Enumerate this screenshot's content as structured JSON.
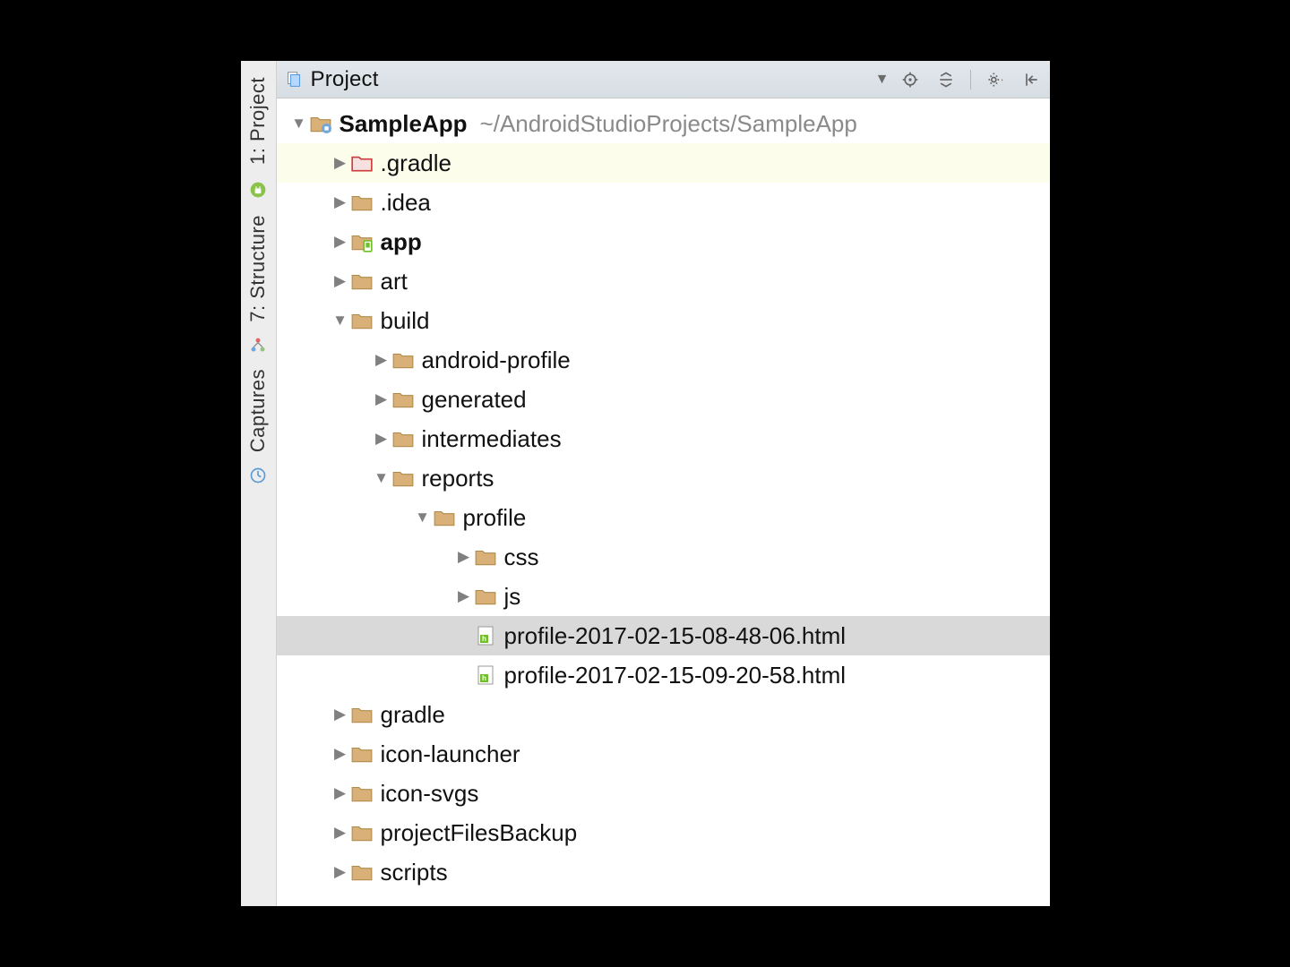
{
  "leftRail": {
    "tabs": [
      {
        "id": "project",
        "label": "1: Project"
      },
      {
        "id": "structure",
        "label": "7: Structure"
      },
      {
        "id": "captures",
        "label": "Captures"
      }
    ]
  },
  "titleBar": {
    "title": "Project"
  },
  "tree": {
    "rootName": "SampleApp",
    "rootPath": "~/AndroidStudioProjects/SampleApp",
    "nodes": [
      {
        "depth": 0,
        "expanded": true,
        "iconType": "module",
        "label": "SampleApp",
        "bold": true,
        "pathHint": "~/AndroidStudioProjects/SampleApp"
      },
      {
        "depth": 1,
        "expanded": false,
        "iconType": "folder-red",
        "label": ".gradle",
        "highlight": true
      },
      {
        "depth": 1,
        "expanded": false,
        "iconType": "folder",
        "label": ".idea"
      },
      {
        "depth": 1,
        "expanded": false,
        "iconType": "app-module",
        "label": "app",
        "bold": true
      },
      {
        "depth": 1,
        "expanded": false,
        "iconType": "folder",
        "label": "art"
      },
      {
        "depth": 1,
        "expanded": true,
        "iconType": "folder",
        "label": "build"
      },
      {
        "depth": 2,
        "expanded": false,
        "iconType": "folder",
        "label": "android-profile"
      },
      {
        "depth": 2,
        "expanded": false,
        "iconType": "folder",
        "label": "generated"
      },
      {
        "depth": 2,
        "expanded": false,
        "iconType": "folder",
        "label": "intermediates"
      },
      {
        "depth": 2,
        "expanded": true,
        "iconType": "folder",
        "label": "reports"
      },
      {
        "depth": 3,
        "expanded": true,
        "iconType": "folder",
        "label": "profile"
      },
      {
        "depth": 4,
        "expanded": false,
        "iconType": "folder",
        "label": "css"
      },
      {
        "depth": 4,
        "expanded": false,
        "iconType": "folder",
        "label": "js"
      },
      {
        "depth": 4,
        "leaf": true,
        "iconType": "html",
        "label": "profile-2017-02-15-08-48-06.html",
        "selected": true
      },
      {
        "depth": 4,
        "leaf": true,
        "iconType": "html",
        "label": "profile-2017-02-15-09-20-58.html"
      },
      {
        "depth": 1,
        "expanded": false,
        "iconType": "folder",
        "label": "gradle"
      },
      {
        "depth": 1,
        "expanded": false,
        "iconType": "folder",
        "label": "icon-launcher"
      },
      {
        "depth": 1,
        "expanded": false,
        "iconType": "folder",
        "label": "icon-svgs"
      },
      {
        "depth": 1,
        "expanded": false,
        "iconType": "folder",
        "label": "projectFilesBackup"
      },
      {
        "depth": 1,
        "expanded": false,
        "iconType": "folder",
        "label": "scripts"
      }
    ]
  },
  "colors": {
    "folderFill": "#d9b178",
    "folderRedFill": "#f7e0e0",
    "folderRedStroke": "#cc3a3a",
    "htmlGreen": "#6fbf2b"
  }
}
